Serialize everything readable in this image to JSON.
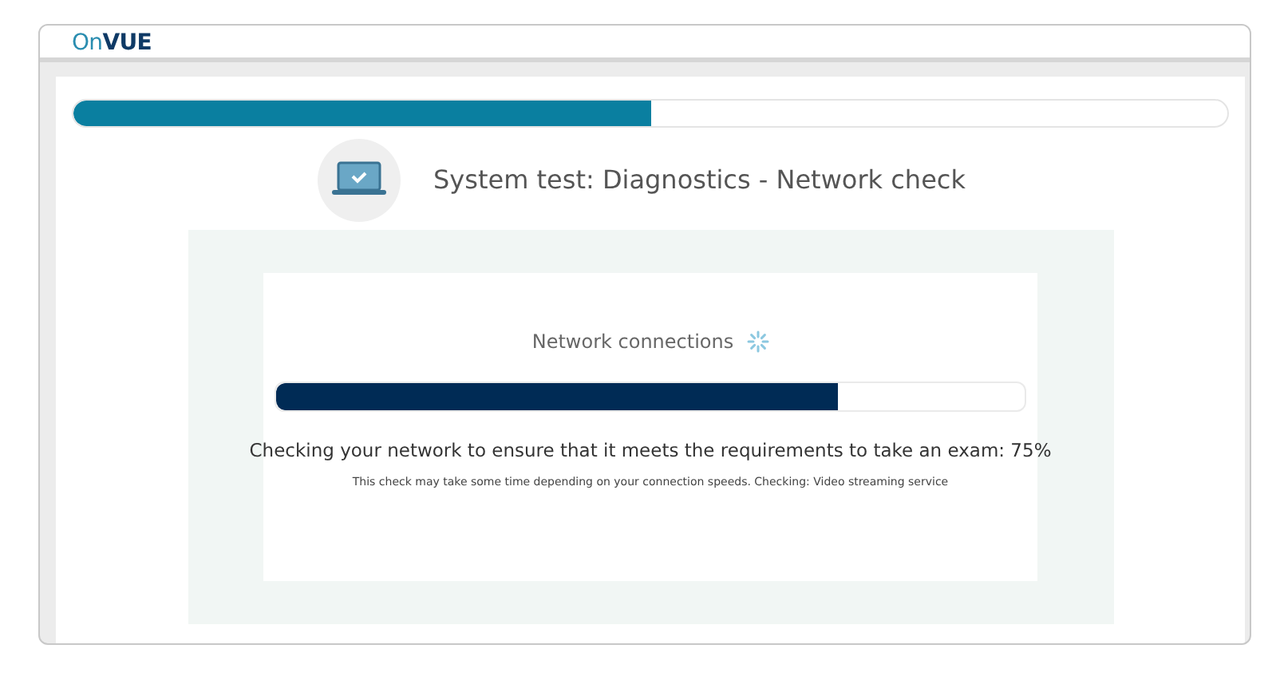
{
  "logo": {
    "prefix": "On",
    "suffix": "VUE"
  },
  "overall_progress": {
    "level": 0.5
  },
  "title": "System test: Diagnostics - Network check",
  "card": {
    "heading": "Network connections",
    "loading": true,
    "progress": {
      "level": 0.75
    },
    "message": "Checking your network to ensure that it meets the requirements to take an exam: 75%",
    "note": "This check may take some time depending on your connection speeds. Checking: Video streaming service"
  }
}
